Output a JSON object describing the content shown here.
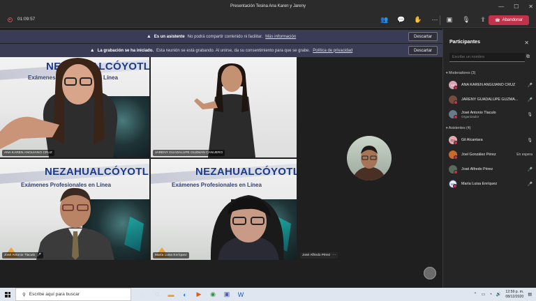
{
  "window": {
    "title": "Presentación Tesina Ana Karen y Jareny"
  },
  "toolbar": {
    "timer": "01:09:57",
    "leave_label": "Abandonar"
  },
  "banners": [
    {
      "bold": "Es un asistente",
      "text": "No podrá compartir contenido ni facilitar.",
      "link": "Más información",
      "button": "Descartar"
    },
    {
      "bold": "La grabación se ha iniciado.",
      "text": "Esta reunión se está grabando. Al unirse, da su consentimiento para que se grabe.",
      "link": "Política de privacidad",
      "button": "Descartar"
    }
  ],
  "slide": {
    "title": "NEZAHUALCÓYOTL",
    "subtitle": "Exámenes Profesionales en Línea"
  },
  "tiles": [
    {
      "name": "ANA KAREN ANGUIANO CRUZ"
    },
    {
      "name": "JARENY GUADALUPE GUZMAN CANUERO"
    },
    {
      "name": "José Antonio Tlaculo"
    },
    {
      "name": "María Luisa Enríquez"
    },
    {
      "name": "José Alfredo Pérez"
    }
  ],
  "panel": {
    "title": "Participantes",
    "search_placeholder": "Escribe un nombre",
    "presenters_heading": "Moderadores (3)",
    "attendees_heading": "Asistentes (4)",
    "presenters": [
      {
        "initials": "AC",
        "name": "ANA KAREN ANGUIANO CRUZ",
        "sub": "",
        "color": "#d9a3b3"
      },
      {
        "initials": "",
        "name": "JARENY GUADALUPE GUZMA...",
        "sub": "",
        "color": "#7a4b3a"
      },
      {
        "initials": "",
        "name": "José Antonio Tlaculo",
        "sub": "Organizador",
        "color": "#6a7a8a"
      }
    ],
    "attendees": [
      {
        "initials": "GA",
        "name": "Gil Alcantara",
        "sub": "",
        "status": "",
        "color": "#e4a8b0"
      },
      {
        "initials": "",
        "name": "Joel González Pérez",
        "sub": "",
        "status": "En espera",
        "color": "#c86a2a"
      },
      {
        "initials": "",
        "name": "José Alfredo Pérez",
        "sub": "",
        "status": "",
        "color": "#5a6a5a"
      },
      {
        "initials": "ML",
        "name": "María Luisa Enríquez",
        "sub": "",
        "status": "",
        "color": "#3b4b88"
      }
    ]
  },
  "taskbar": {
    "search_text": "Escribe aquí para buscar",
    "time": "12:59 p. m.",
    "date": "08/12/2020"
  }
}
